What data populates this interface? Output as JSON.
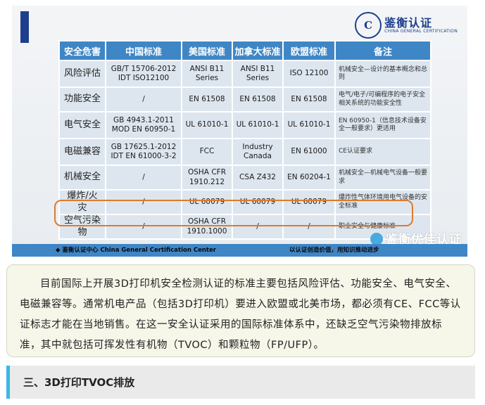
{
  "slide": {
    "logo": {
      "mark": "C",
      "name_cn": "鉴衡认证",
      "name_en": "CHINA GENERAL CERTIFICATION"
    },
    "table": {
      "headers": [
        "安全危害",
        "中国标准",
        "美国标准",
        "加拿大标准",
        "欧盟标准",
        "备注"
      ],
      "rows": [
        [
          "风险评估",
          "GB/T 15706-2012\nIDT ISO12100",
          "ANSI B11\nSeries",
          "ANSI B11\nSeries",
          "ISO 12100",
          "机械安全—设计的基本概念和总则"
        ],
        [
          "功能安全",
          "/",
          "EN 61508",
          "EN 61508",
          "EN 61508",
          "电气/电子/可编程序的电子安全相关系统的功能安全性"
        ],
        [
          "电气安全",
          "GB 4943.1-2011\nMOD EN 60950-1",
          "UL 61010-1",
          "UL 61010-1",
          "UL 61010-1",
          "EN 60950-1（信息技术设备安全一般要求）更适用"
        ],
        [
          "电磁兼容",
          "GB 17625.1-2012\nIDT EN 61000-3-2",
          "FCC",
          "Industry\nCanada",
          "EN 61000",
          "CE认证要求"
        ],
        [
          "机械安全",
          "/",
          "OSHA CFR\n1910.212",
          "CSA Z432",
          "EN 60204-1",
          "机械安全—机械电气设备一般要求"
        ],
        [
          "爆炸/火灾",
          "/",
          "UL 60079",
          "UL 60079",
          "UL 60079",
          "爆炸性气体环境用电气设备的安全标准"
        ],
        [
          "空气污染物",
          "/",
          "OSHA CFR\n1910.1000",
          "/",
          "/",
          "职业安全与健康标准"
        ]
      ]
    },
    "watermark": "鉴衡优佳认证",
    "footer": {
      "left": "◆ 鉴衡认证中心   China General Certification Center",
      "right": "以认证创造价值，用知识推动进步"
    }
  },
  "paragraph": "目前国际上开展3D打印机安全检测认证的标准主要包括风险评估、功能安全、电气安全、电磁兼容等。通常机电产品（包括3D打印机）要进入欧盟或北美市场，都必须有CE、FCC等认证标志才能在当地销售。在这一安全认证采用的国际标准体系中，还缺乏空气污染物排放标准，其中就包括可挥发性有机物（TVOC）和颗粒物（FP/UFP）。",
  "section_title": "三、3D打印TVOC排放",
  "colors": {
    "header_blue": "#3f86c6",
    "cell_bg": "#dde6ef",
    "highlight": "#e07a29",
    "accent": "#38b9e2"
  }
}
